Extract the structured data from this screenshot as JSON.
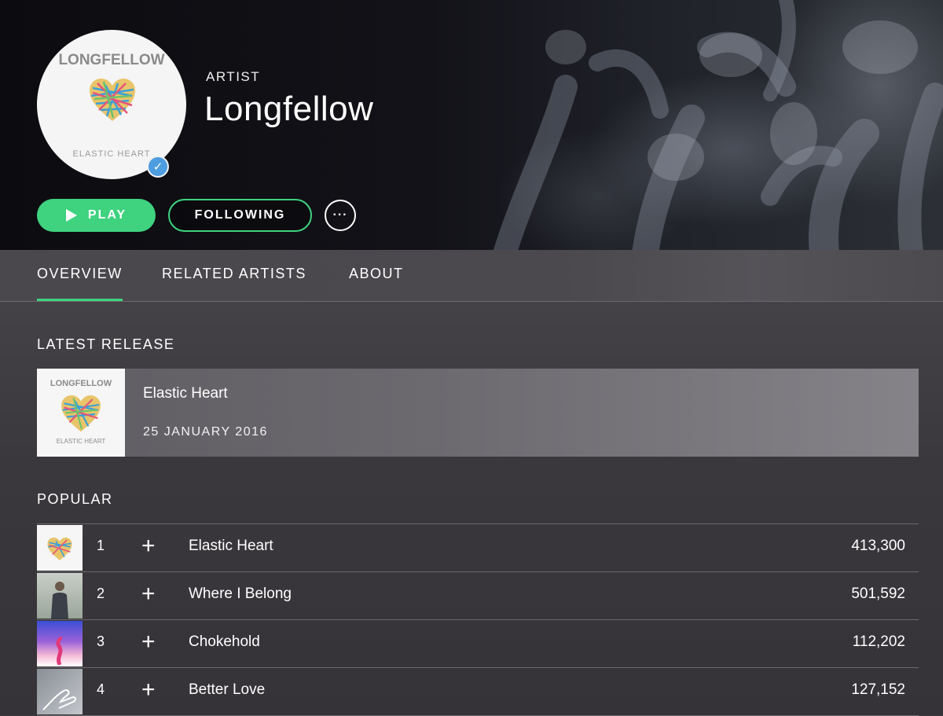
{
  "artist": {
    "kind": "ARTIST",
    "name": "Longfellow",
    "avatar_brand": "LONGFELLOW",
    "avatar_subtitle": "ELASTIC HEART",
    "verified_icon": "check-icon"
  },
  "actions": {
    "play_label": "PLAY",
    "follow_label": "FOLLOWING",
    "more_label": "···"
  },
  "tabs": [
    {
      "label": "OVERVIEW",
      "active": true
    },
    {
      "label": "RELATED ARTISTS",
      "active": false
    },
    {
      "label": "ABOUT",
      "active": false
    }
  ],
  "latest_release": {
    "section_title": "LATEST RELEASE",
    "title": "Elastic Heart",
    "date": "25 JANUARY 2016",
    "thumb_brand": "LONGFELLOW",
    "thumb_subtitle": "ELASTIC HEART"
  },
  "popular": {
    "section_title": "POPULAR",
    "add_symbol": "+",
    "tracks": [
      {
        "num": "1",
        "title": "Elastic Heart",
        "plays": "413,300"
      },
      {
        "num": "2",
        "title": "Where I Belong",
        "plays": "501,592"
      },
      {
        "num": "3",
        "title": "Chokehold",
        "plays": "112,202"
      },
      {
        "num": "4",
        "title": "Better Love",
        "plays": "127,152"
      }
    ]
  },
  "colors": {
    "accent": "#3fd27f",
    "verified": "#4d9de0",
    "background": "#3a383c"
  }
}
